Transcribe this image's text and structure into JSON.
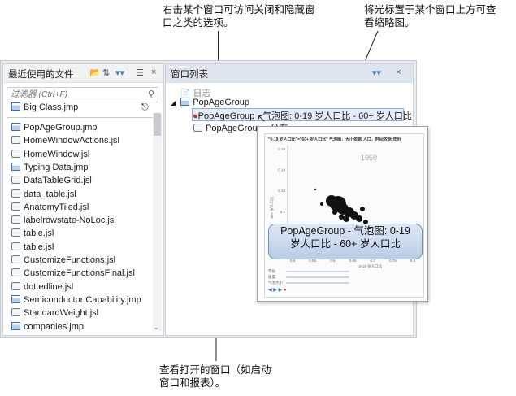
{
  "callouts": {
    "top_left": [
      "右击某个窗口可访问关闭和隐藏窗",
      "口之类的选项。"
    ],
    "top_right": [
      "将光标置于某个窗口上方可查",
      "看缩略图。"
    ],
    "bottom": [
      "查看打开的窗口（如启动",
      "窗口和报表）。"
    ]
  },
  "recent_files": {
    "title": "最近使用的文件",
    "filter_placeholder": "过滤器 (Ctrl+F)",
    "pinned_item": "Big Class.jmp",
    "pin_symbol": "↕",
    "items": [
      {
        "name": "PopAgeGroup.jmp",
        "type": "jmp"
      },
      {
        "name": "HomeWindowActions.jsl",
        "type": "jsl"
      },
      {
        "name": "HomeWindow.jsl",
        "type": "jsl"
      },
      {
        "name": "Typing Data.jmp",
        "type": "jmp"
      },
      {
        "name": "DataTableGrid.jsl",
        "type": "jsl"
      },
      {
        "name": "data_table.jsl",
        "type": "jsl"
      },
      {
        "name": "AnatomyTiled.jsl",
        "type": "jsl"
      },
      {
        "name": "labelrowstate-NoLoc.jsl",
        "type": "jsl"
      },
      {
        "name": "table.jsl",
        "type": "jsl"
      },
      {
        "name": "table.jsl",
        "type": "jsl"
      },
      {
        "name": "CustomizeFunctions.jsl",
        "type": "jsl"
      },
      {
        "name": "CustomizeFunctionsFinal.jsl",
        "type": "jsl"
      },
      {
        "name": "dottedline.jsl",
        "type": "jsl"
      },
      {
        "name": "Semiconductor Capability.jmp",
        "type": "jmp"
      },
      {
        "name": "StandardWeight.jsl",
        "type": "jsl"
      },
      {
        "name": "companies.jmp",
        "type": "jmp"
      }
    ]
  },
  "window_list": {
    "title": "窗口列表",
    "log": "日志",
    "group": "PopAgeGroup",
    "report": "PopAgeGroup - 气泡图: 0-19 岁人口比 - 60+ 岁人口比",
    "partial_item": "PopAgeGroup - 分布"
  },
  "thumbnail": {
    "header": "\"0-19 岁人口比\"=\"60+ 岁人口比\" 气泡图，大小依据:人口，时间依据:年份",
    "year_label": "1950",
    "y_ticks": [
      "0.16",
      "0.14",
      "0.12",
      "0.1",
      "0.08",
      "0.06"
    ],
    "x_ticks": [
      "0.5",
      "0.55",
      "0.6",
      "0.65",
      "0.7",
      "0.75",
      "0.8"
    ],
    "ylabel": "60+ 岁人口比",
    "xlabel": "0-19 岁人口比",
    "controls": [
      "年份",
      "速度",
      "气泡大小"
    ]
  },
  "tooltip": {
    "line1": "PopAgeGroup - 气泡图: 0-19",
    "line2": "岁人口比 - 60+ 岁人口比"
  },
  "colors": {
    "accent": "#3c6ea8",
    "bubble": "#111111"
  }
}
